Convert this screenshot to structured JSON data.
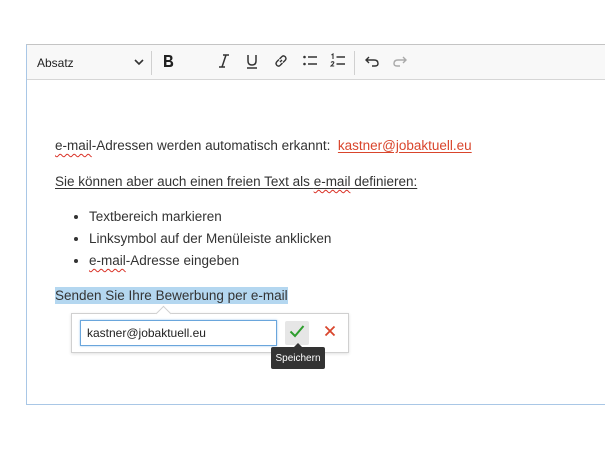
{
  "toolbar": {
    "format_value": "Absatz",
    "buttons": [
      "bold-icon",
      "italic-icon",
      "underline-icon",
      "link-icon",
      "bulleted-list-icon",
      "numbered-list-icon",
      "undo-icon",
      "redo-icon"
    ]
  },
  "content": {
    "line1_part1": "e-mail",
    "line1_part2": "-Adressen werden automatisch erkannt:",
    "line1_link": "kastner@jobaktuell.eu",
    "line2_part1": "Sie können aber auch einen freien Text als ",
    "line2_part2": "e-mail",
    "line2_part3": " definieren:",
    "list": {
      "item1": "Textbereich markieren",
      "item2": "Linksymbol auf der Menüleiste anklicken",
      "item3_part1": "e-mail",
      "item3_part2": "-Adresse eingeben"
    },
    "selected_text": "Senden Sie Ihre Bewerbung per e-mail"
  },
  "link_popup": {
    "url_value": "kastner@jobaktuell.eu",
    "save_tooltip": "Speichern"
  },
  "colors": {
    "link": "#d9452c",
    "selection": "#b4d7f0",
    "save_check": "#2e9e2e",
    "cancel_x": "#d9452c"
  }
}
